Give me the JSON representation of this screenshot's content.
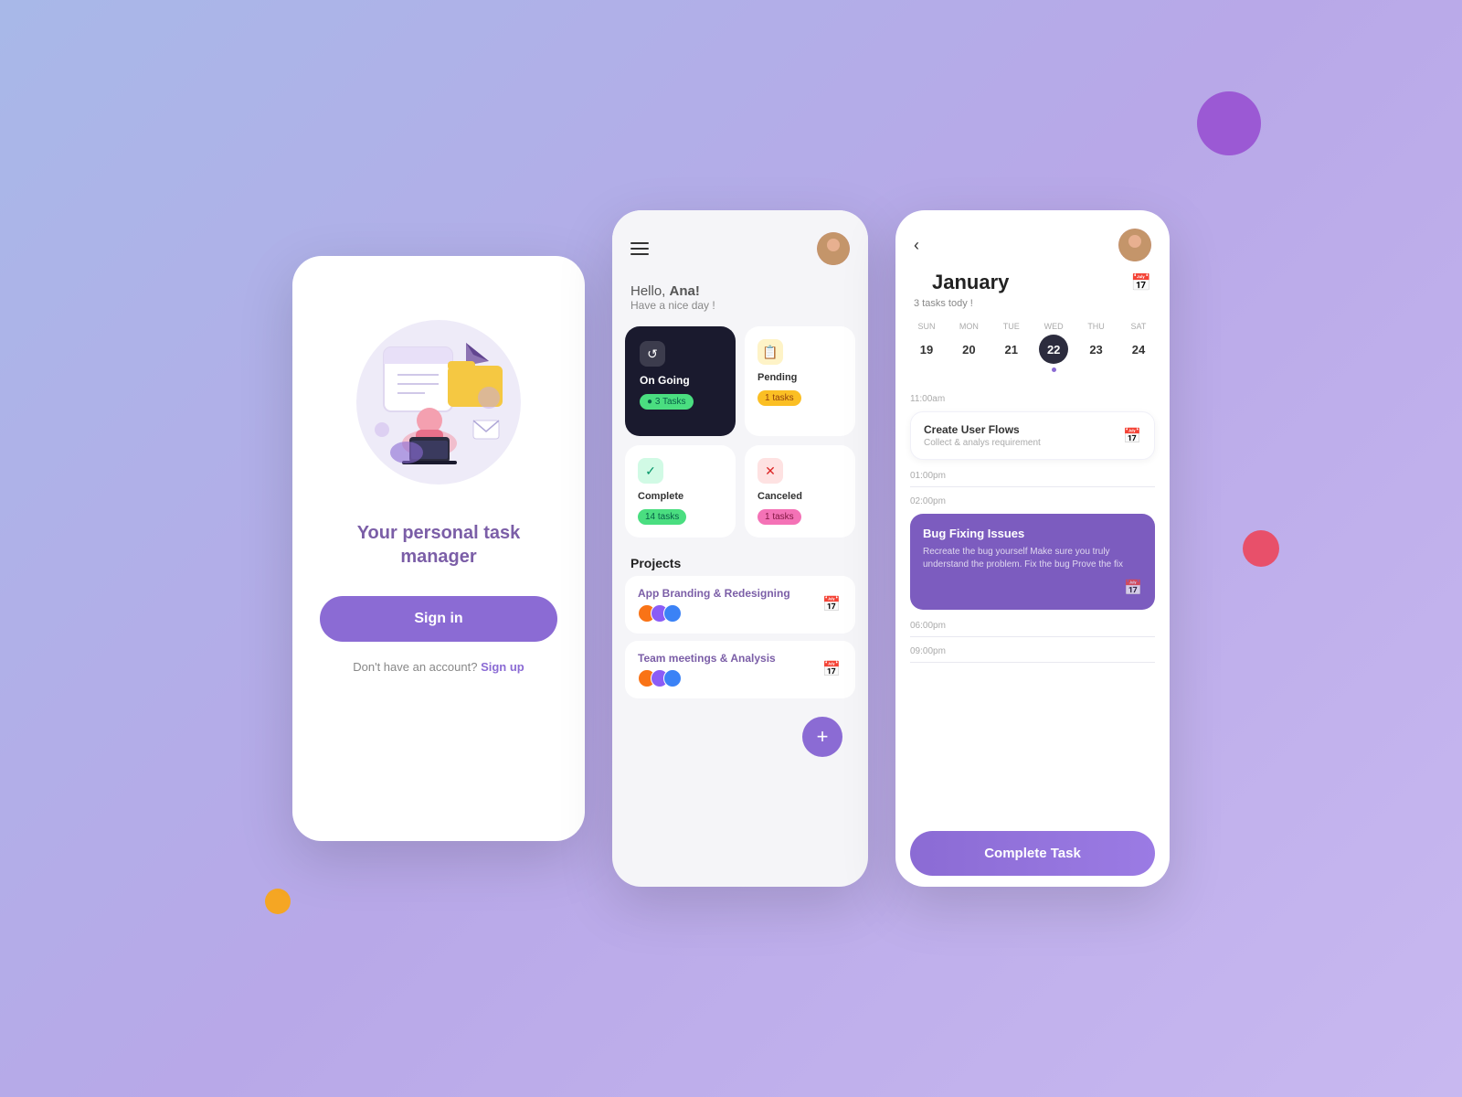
{
  "decorations": {
    "circle_purple_color": "#9b59d4",
    "circle_orange_color": "#f5a623",
    "circle_red_color": "#e8506a"
  },
  "screen_login": {
    "title": "Your personal task manager",
    "signin_label": "Sign in",
    "no_account_text": "Don't have an account?",
    "signup_label": "Sign up"
  },
  "screen_dashboard": {
    "greeting_hello": "Hello, ",
    "greeting_name": "Ana!",
    "greeting_sub": "Have a nice day !",
    "cards": {
      "ongoing": {
        "title": "On Going",
        "count": "● 3 Tasks"
      },
      "pending": {
        "title": "Pending",
        "count": "1 tasks"
      },
      "complete": {
        "title": "Complete",
        "count": "14 tasks"
      },
      "canceled": {
        "title": "Canceled",
        "count": "1 tasks"
      }
    },
    "projects_label": "Projects",
    "projects": [
      {
        "name": "App Branding & Redesigning"
      },
      {
        "name": "Team meetings & Analysis"
      }
    ],
    "fab_label": "+"
  },
  "screen_calendar": {
    "month": "January",
    "tasks_today": "3 tasks tody !",
    "days": [
      {
        "name": "SUN",
        "num": "19"
      },
      {
        "name": "MON",
        "num": "20"
      },
      {
        "name": "TUE",
        "num": "21"
      },
      {
        "name": "WED",
        "num": "22",
        "active": true,
        "dot": true
      },
      {
        "name": "THU",
        "num": "23"
      },
      {
        "name": "SAT",
        "num": "24"
      }
    ],
    "times": [
      "11:00am",
      "01:00pm",
      "02:00pm",
      "06:00pm",
      "09:00pm"
    ],
    "events": [
      {
        "time": "11:00am",
        "title": "Create User Flows",
        "sub": "Collect & analys requirement",
        "type": "white"
      },
      {
        "time": "02:00pm",
        "title": "Bug Fixing Issues",
        "desc": "Recreate the bug yourself Make sure you truly understand the problem. Fix the bug Prove the fix",
        "type": "purple"
      }
    ],
    "complete_task_label": "Complete Task"
  }
}
